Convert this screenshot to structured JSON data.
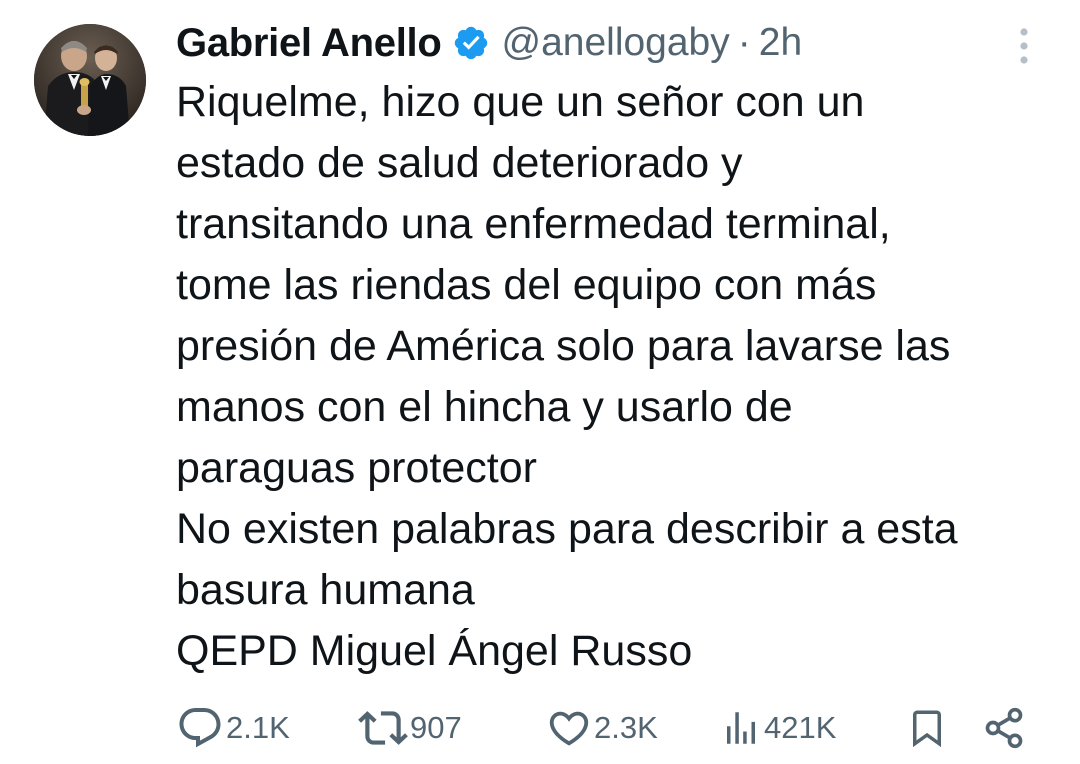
{
  "author": {
    "display_name": "Gabriel Anello",
    "handle": "@anellogaby",
    "separator": "·",
    "time": "2h",
    "verified": true,
    "avatar_icon": "profile-photo"
  },
  "tweet": {
    "lines": [
      "Riquelme, hizo que un señor con un",
      "estado de salud deteriorado y",
      "transitando una enfermedad terminal,",
      "tome las riendas del equipo con más",
      "presión de América solo para lavarse las",
      "manos con el hincha y usarlo de",
      "paraguas protector",
      "No existen palabras para describir a esta",
      "basura humana",
      "QEPD Miguel Ángel Russo"
    ]
  },
  "actions": {
    "replies": "2.1K",
    "retweets": "907",
    "likes": "2.3K",
    "views": "421K"
  },
  "colors": {
    "text": "#0f1419",
    "secondary": "#536471",
    "verified": "#1d9bf0",
    "background": "#ffffff"
  }
}
